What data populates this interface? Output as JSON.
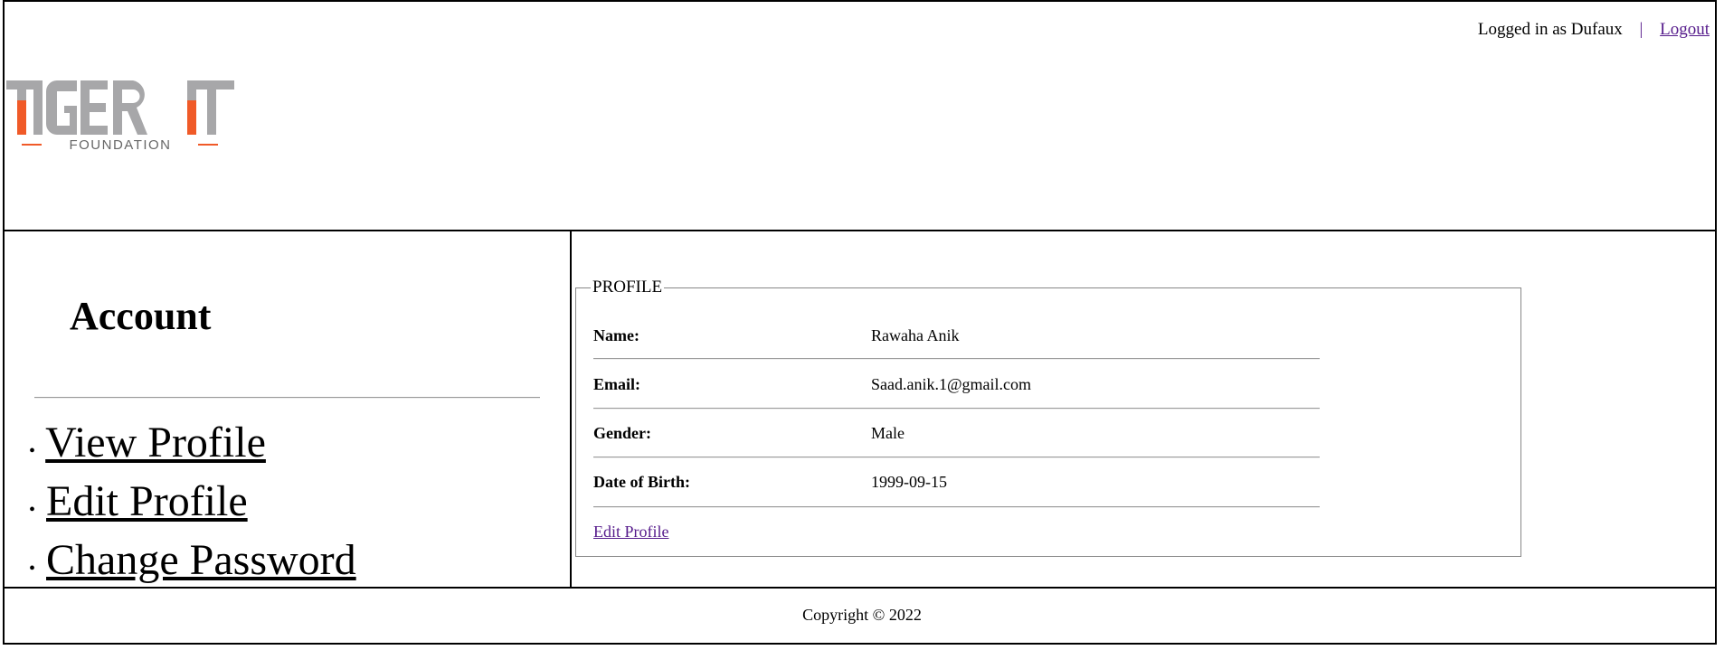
{
  "header": {
    "logged_in_text": "Logged in as Dufaux",
    "separator": "|",
    "logout_label": "Logout",
    "logo": {
      "main": "TIGER IT",
      "sub": "FOUNDATION",
      "accent": "#f05a28",
      "gray": "#a7a7a9"
    }
  },
  "sidebar": {
    "title": "Account",
    "items": [
      {
        "label": "View Profile"
      },
      {
        "label": "Edit Profile"
      },
      {
        "label": "Change Password"
      }
    ]
  },
  "profile": {
    "legend": "PROFILE",
    "rows": [
      {
        "label": "Name:",
        "value": "Rawaha Anik"
      },
      {
        "label": "Email:",
        "value": "Saad.anik.1@gmail.com"
      },
      {
        "label": "Gender:",
        "value": "Male"
      },
      {
        "label": "Date of Birth:",
        "value": "1999-09-15"
      }
    ],
    "edit_link": "Edit Profile"
  },
  "footer": {
    "copyright": "Copyright © 2022"
  }
}
